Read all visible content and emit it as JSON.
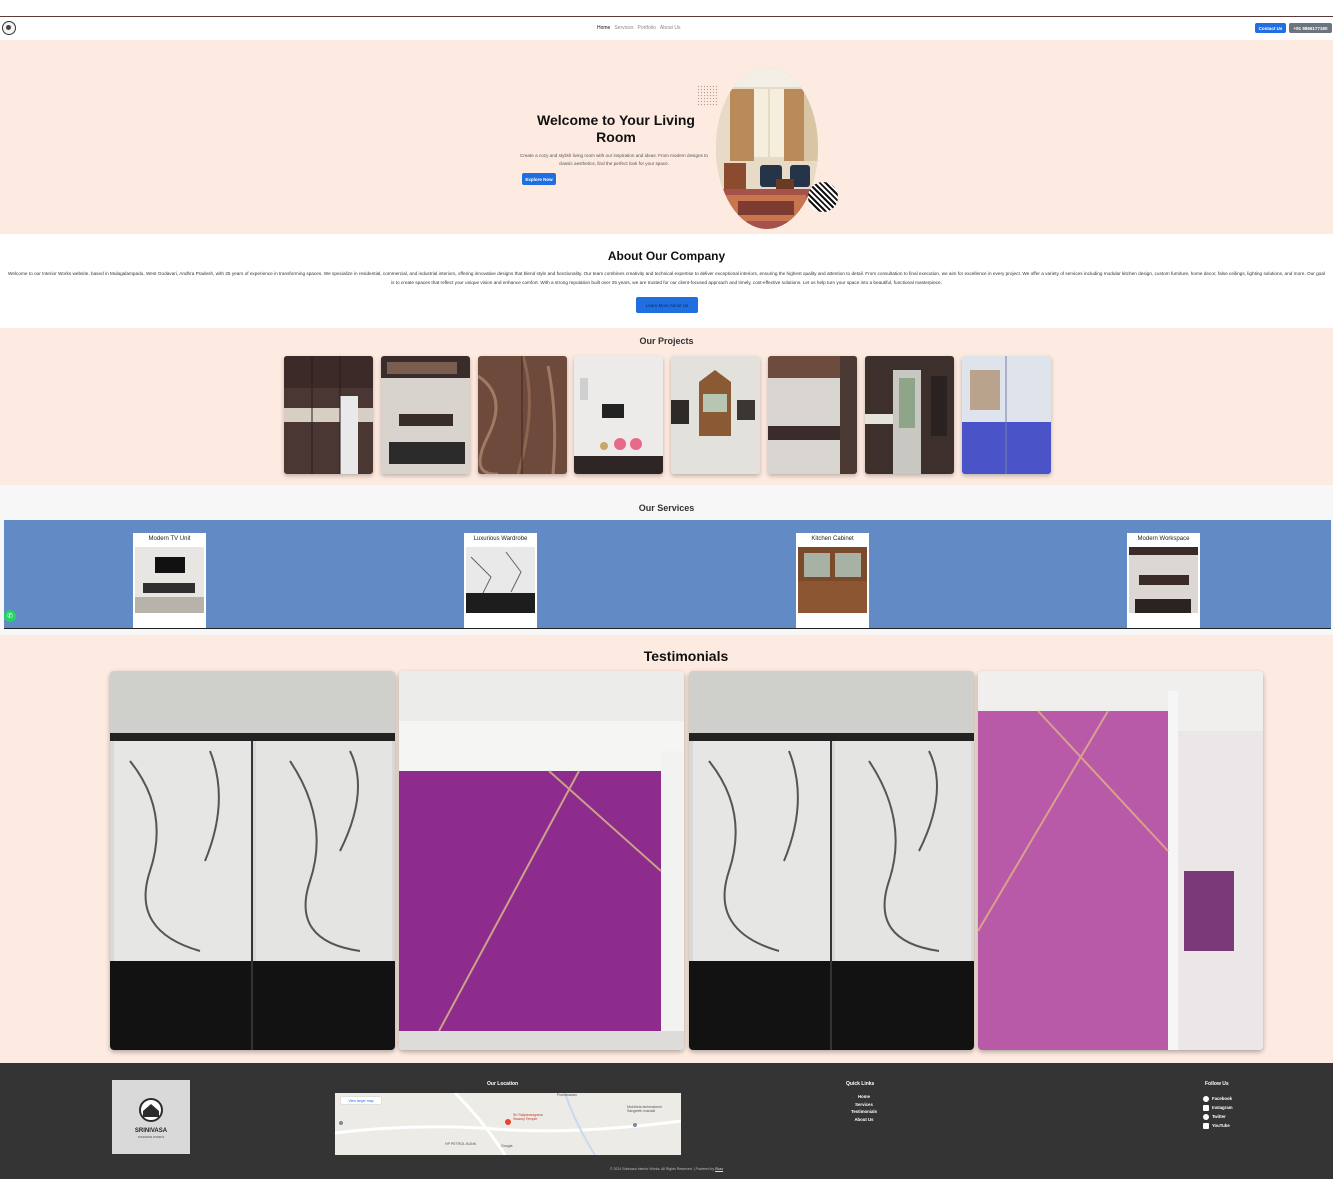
{
  "nav": {
    "links": [
      "Home",
      "Services",
      "Portfolio",
      "About Us"
    ],
    "contact_button": "Contact Us",
    "phone_button": "+91 9866177180"
  },
  "hero": {
    "title": "Welcome to Your Living Room",
    "description": "Create a cozy and stylish living room with our inspiration and ideas. From modern designs to classic aesthetics, find the perfect look for your space.",
    "button": "Explore Now"
  },
  "about": {
    "title": "About Our Company",
    "text": "Welcome to our Interior Works website, based in Mulagalampadu, West Godavari, Andhra Pradesh, with 25 years of experience in transforming spaces. We specialize in residential, commercial, and industrial interiors, offering innovative designs that blend style and functionality. Our team combines creativity and technical expertise to deliver exceptional interiors, ensuring the highest quality and attention to detail. From consultation to final execution, we aim for excellence in every project. We offer a variety of services including modular kitchen design, custom furniture, home decor, false ceilings, lighting solutions, and more. Our goal is to create spaces that reflect your unique vision and enhance comfort. With a strong reputation built over 25 years, we are trusted for our client-focused approach and timely, cost-effective solutions. Let us help turn your space into a beautiful, functional masterpiece.",
    "button": "Learn More About Us"
  },
  "projects": {
    "title": "Our Projects"
  },
  "services": {
    "title": "Our Services",
    "items": [
      "Modern TV Unit",
      "Luxurious Wardrobe",
      "Kitchen Cabinet",
      "Modern Workspace"
    ]
  },
  "testimonials": {
    "title": "Testimonials"
  },
  "footer": {
    "logo_text": "SRINIVASA",
    "logo_subtext": "INTERIOR WORKS",
    "location_title": "Our Location",
    "map": {
      "view_larger": "View larger map",
      "place_1": "Pochavaram",
      "place_2": "Sri Satyanarayana Swamy Temple",
      "place_3": "Mukthela lachmakesh Sangeeth mandal",
      "place_4": "HP PETROL BUNK",
      "place_5": "Google"
    },
    "quick_links_title": "Quick Links",
    "quick_links": [
      "Home",
      "Services",
      "Testimonials",
      "About Us"
    ],
    "follow_title": "Follow Us",
    "social": [
      "Facebook",
      "Instagram",
      "Twitter",
      "YouTube"
    ],
    "copyright": "© 2024 Srinivasa Interior Works. All Rights Reserved. | Powered by ",
    "copyright_link": "Ebaz"
  },
  "colors": {
    "accent": "#1f6fe0",
    "hero_bg": "#fdeae0",
    "services_band": "#628ac4",
    "footer_bg": "#343434"
  }
}
